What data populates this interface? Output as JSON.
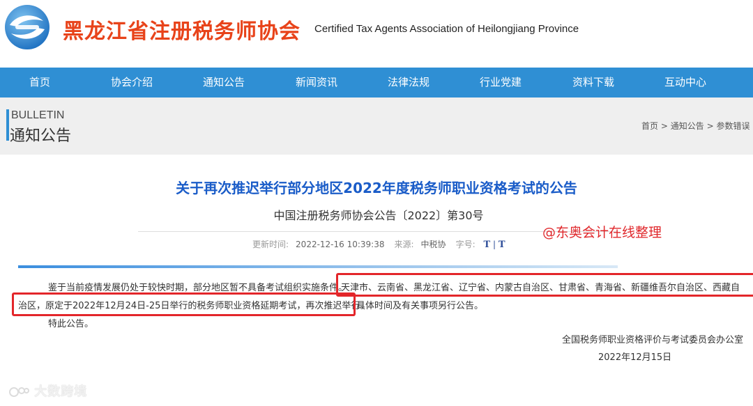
{
  "header": {
    "site_name_cn": "黑龙江省注册税务师协会",
    "site_name_en": "Certified Tax Agents Association of Heilongjiang Province",
    "logo_icon": "association-logo-icon"
  },
  "nav": {
    "items": [
      "首页",
      "协会介绍",
      "通知公告",
      "新闻资讯",
      "法律法规",
      "行业党建",
      "资料下载",
      "互动中心"
    ]
  },
  "banner": {
    "en": "BULLETIN",
    "cn": "通知公告",
    "breadcrumb": [
      "首页",
      ">",
      "通知公告",
      ">",
      "参数错误"
    ]
  },
  "article": {
    "title": "关于再次推迟举行部分地区2022年度税务师职业资格考试的公告",
    "subtitle": "中国注册税务师协会公告〔2022〕第30号",
    "meta": {
      "updated_label": "更新时间:",
      "updated_value": "2022-12-16 10:39:38",
      "source_label": "来源:",
      "source_value": "中税协",
      "font_label": "字号:",
      "font_large": "T",
      "font_sep": "|",
      "font_small": "T"
    },
    "para1_a": "鉴于当前疫情发展仍处于较快时期，部分地区暂不具备考试组织实施条件。",
    "para1_b": "天津市、云南省、黑龙江省、辽宁省、内蒙古自治区、甘肃省、青海省、新疆维吾尔自治区、西藏自",
    "para2_a": "治区，原定于2022年12月24日-25日举行的税务师职业资格延期考试，再次推迟举行。",
    "para2_b": "具体时间及有关事项另行公告。",
    "para3": "特此公告。",
    "signature": "全国税务师职业资格评价与考试委员会办公室",
    "date": "2022年12月15日"
  },
  "overlay": {
    "watermark_red": "@东奥会计在线整理",
    "watermark_bottom": "大数跨境"
  },
  "colors": {
    "brand_red": "#e8431a",
    "nav_blue": "#2f8fd4",
    "title_blue": "#1a5cc8",
    "highlight_red": "#e3262a"
  }
}
